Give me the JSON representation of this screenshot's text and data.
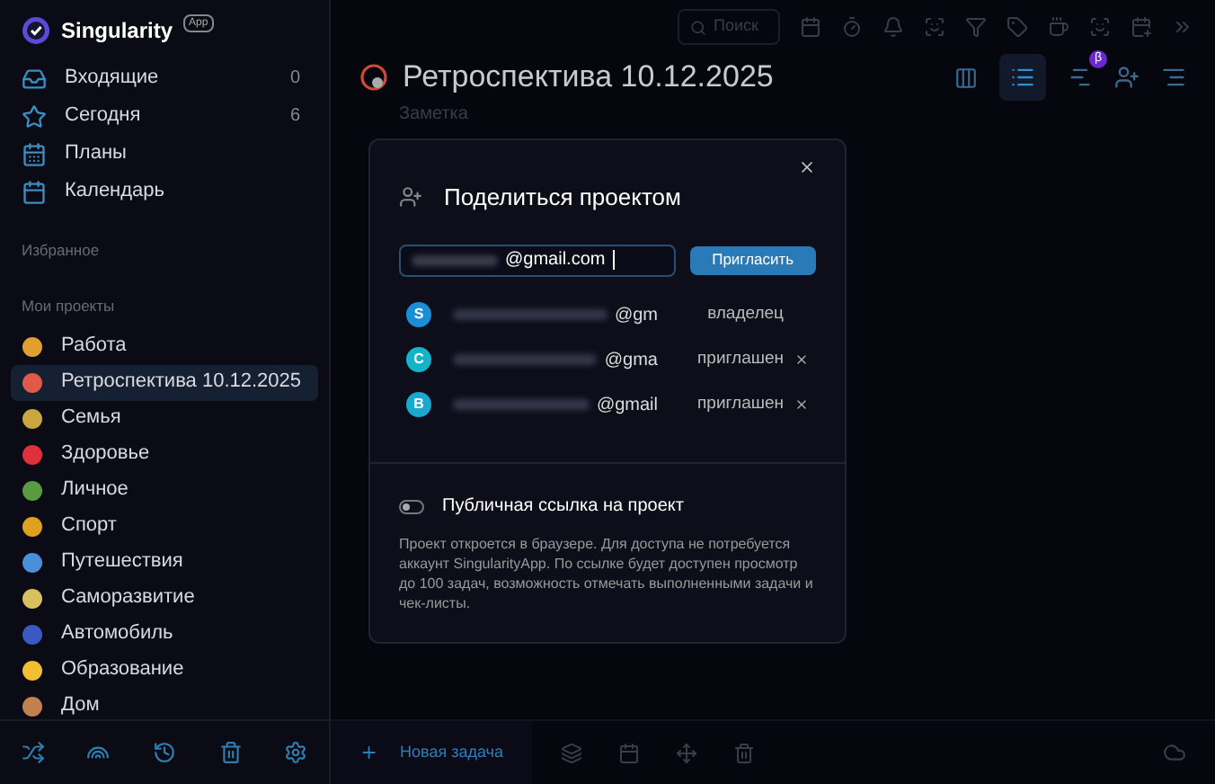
{
  "app": {
    "name": "Singularity",
    "badge": "App"
  },
  "sidebar": {
    "nav": [
      {
        "label": "Входящие",
        "count": "0",
        "selected": false
      },
      {
        "label": "Сегодня",
        "count": "6",
        "selected": false
      },
      {
        "label": "Планы",
        "selected": false
      },
      {
        "label": "Календарь",
        "selected": false
      }
    ],
    "favorites_heading": "Избранное",
    "projects_heading": "Мои проекты",
    "projects": [
      {
        "label": "Работа",
        "selected": false,
        "color": "#e0a030"
      },
      {
        "label": "Ретроспектива 10.12.2025",
        "selected": true,
        "color": "#e05a4a"
      },
      {
        "label": "Семья",
        "selected": false,
        "color": "#c9a640"
      },
      {
        "label": "Здоровье",
        "selected": false,
        "color": "#e0303a"
      },
      {
        "label": "Личное",
        "selected": false,
        "color": "#5a9a40"
      },
      {
        "label": "Спорт",
        "selected": false,
        "color": "#e0a020"
      },
      {
        "label": "Путешествия",
        "selected": false,
        "color": "#4a90d8"
      },
      {
        "label": "Саморазвитие",
        "selected": false,
        "color": "#d8c060"
      },
      {
        "label": "Автомобиль",
        "selected": false,
        "color": "#3a5ac0"
      },
      {
        "label": "Образование",
        "selected": false,
        "color": "#f0c030"
      },
      {
        "label": "Дом",
        "selected": false,
        "color": "#c08050"
      }
    ]
  },
  "toolbar": {
    "search_placeholder": "Поиск",
    "beta_badge": "β"
  },
  "project": {
    "title": "Ретроспектива 10.12.2025",
    "subtitle": "Заметка"
  },
  "share_dialog": {
    "title": "Поделиться проектом",
    "email_value": "@gmail.com",
    "invite_button": "Пригласить",
    "members": [
      {
        "initial": "S",
        "email": "@gm",
        "role": "владелец",
        "removable": false,
        "color": "#1a8fd8"
      },
      {
        "initial": "C",
        "email": "@gma",
        "role": "приглашен",
        "removable": true,
        "color": "#14b3c8"
      },
      {
        "initial": "B",
        "email": "@gmail",
        "role": "приглашен",
        "removable": true,
        "color": "#18a8d0"
      }
    ],
    "public_link": {
      "label": "Публичная ссылка на проект",
      "on": false
    },
    "description": "Проект откроется в браузере. Для доступа не потребуется аккаунт SingularityApp. По ссылке будет доступен просмотр до 100 задач, возможность отмечать выполненными задачи и чек-листы."
  },
  "bottom_bar": {
    "new_task": "Новая задача"
  }
}
